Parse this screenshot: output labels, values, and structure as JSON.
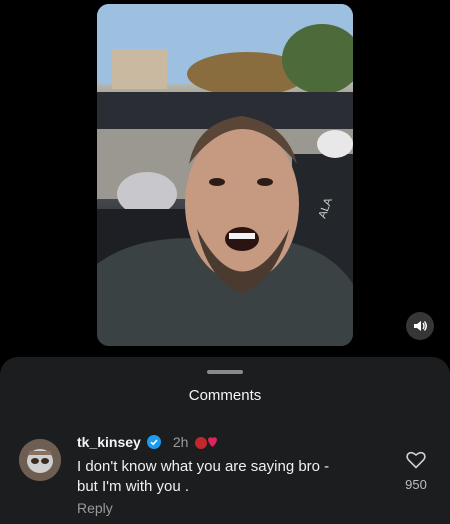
{
  "video": {
    "mute_icon": "volume-icon",
    "police_vest_text": "ALA"
  },
  "comments_sheet": {
    "title": "Comments",
    "comment": {
      "username": "tk_kinsey",
      "verified_icon": "verified-badge-icon",
      "time": "2h",
      "reaction_icon": "boxing-glove-heart-icon",
      "text_line1": "I don't know what you are saying bro -",
      "text_line2": "but I'm with you .",
      "reply_label": "Reply",
      "like_icon": "heart-outline-icon",
      "like_count": "950"
    }
  },
  "colors": {
    "background": "#000000",
    "sheet": "#1c1d1f",
    "verified": "#1d9bf0",
    "muted_text": "#9a9a9a"
  }
}
